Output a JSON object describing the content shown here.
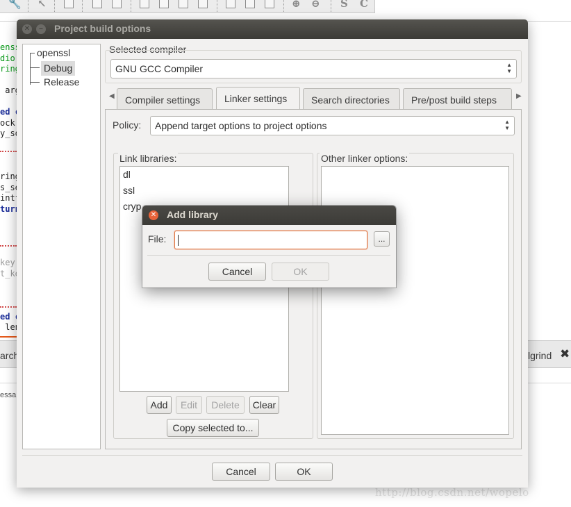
{
  "background": {
    "code_fragments": [
      {
        "text": "enss",
        "color": "#0a9a1a"
      },
      {
        "text": "dio.",
        "color": "#0a9a1a"
      },
      {
        "text": "ring",
        "color": "#0a9a1a"
      },
      {
        "text": "",
        "color": "#222222"
      },
      {
        "text": " arg",
        "color": "#222222"
      },
      {
        "text": "",
        "color": "#222222"
      },
      {
        "text": "ed c",
        "color": "#1c2e99"
      },
      {
        "text": "ock",
        "color": "#222222"
      },
      {
        "text": "y_so",
        "color": "#222222"
      },
      {
        "text": "",
        "color": "#222222"
      },
      {
        "text": "",
        "color": "#222222"
      },
      {
        "text": "",
        "color": "#222222"
      },
      {
        "text": "ring",
        "color": "#222222"
      },
      {
        "text": "s_se",
        "color": "#222222"
      },
      {
        "text": "intf",
        "color": "#222222"
      },
      {
        "text": "turn",
        "color": "#1c2e99"
      },
      {
        "text": "",
        "color": "#222222"
      },
      {
        "text": "",
        "color": "#222222"
      },
      {
        "text": "",
        "color": "#222222"
      },
      {
        "text": "",
        "color": "#222222"
      },
      {
        "text": "key",
        "color": "#9a9a9a"
      },
      {
        "text": "t_ke",
        "color": "#9a9a9a"
      },
      {
        "text": "",
        "color": "#222222"
      },
      {
        "text": "",
        "color": "#222222"
      },
      {
        "text": "",
        "color": "#222222"
      },
      {
        "text": "ed c",
        "color": "#1c2e99"
      },
      {
        "text": " len",
        "color": "#222222"
      }
    ],
    "bottom_tab_left": "arch",
    "bottom_tab_right": "lgrind",
    "bottom_text": "essa",
    "watermark": "http://blog.csdn.net/wopelo"
  },
  "dialog": {
    "title": "Project build options",
    "tree": {
      "root": "openssl",
      "children": [
        "Debug",
        "Release"
      ],
      "selected": "Debug"
    },
    "selected_compiler_label": "Selected compiler",
    "compiler_value": "GNU GCC Compiler",
    "tabs": [
      {
        "label": "Compiler settings",
        "active": false
      },
      {
        "label": "Linker settings",
        "active": true
      },
      {
        "label": "Search directories",
        "active": false
      },
      {
        "label": "Pre/post build steps",
        "active": false
      }
    ],
    "policy_label": "Policy:",
    "policy_value": "Append target options to project options",
    "link_libraries_label": "Link libraries:",
    "link_libraries": [
      "dl",
      "ssl",
      "cryp"
    ],
    "other_linker_label": "Other linker options:",
    "buttons": {
      "add": "Add",
      "edit": "Edit",
      "delete": "Delete",
      "clear": "Clear",
      "copy": "Copy selected to...",
      "cancel": "Cancel",
      "ok": "OK"
    }
  },
  "add_library_dialog": {
    "title": "Add library",
    "file_label": "File:",
    "file_value": "",
    "browse": "...",
    "cancel": "Cancel",
    "ok": "OK"
  }
}
